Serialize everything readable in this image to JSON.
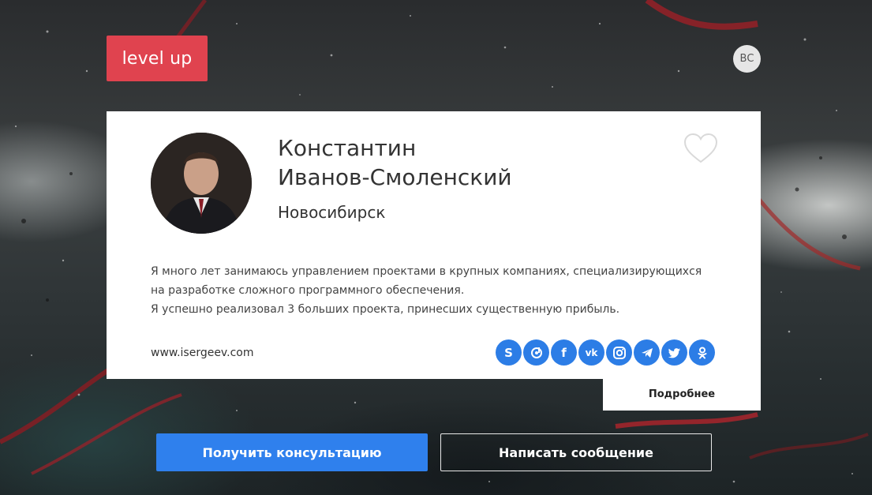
{
  "header": {
    "logo_text": "level up",
    "user_initials": "ВС"
  },
  "profile": {
    "name_line1": "Константин",
    "name_line2": "Иванов-Смоленский",
    "city": "Новосибирск",
    "about_line1": "Я много лет занимаюсь управлением проектами в крупных компаниях, специализирующихся",
    "about_line2": "на разработке сложного программного обеспечения.",
    "about_line3": "Я успешно реализовал 3 больших проекта, принесших существенную прибыль.",
    "website": "www.isergeev.com",
    "more_link": "Подробнее",
    "socials": [
      "skype-icon",
      "tiktok-icon",
      "facebook-icon",
      "vk-icon",
      "instagram-icon",
      "telegram-icon",
      "twitter-icon",
      "odnoklassniki-icon"
    ]
  },
  "actions": {
    "consult_label": "Получить консультацию",
    "message_label": "Написать сообщение"
  },
  "colors": {
    "brand_red": "#e0434f",
    "accent_blue": "#2f80ed",
    "social_blue": "#2c7de6"
  }
}
